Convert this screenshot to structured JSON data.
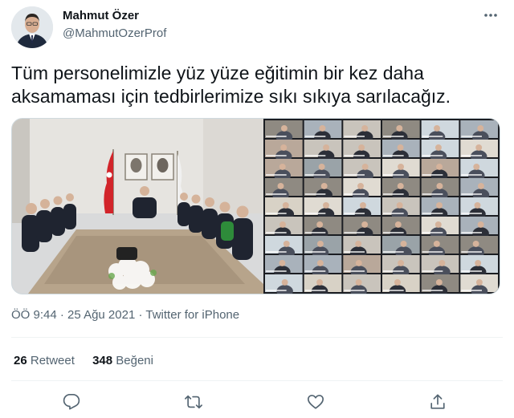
{
  "tweet": {
    "author_name": "Mahmut Özer",
    "author_handle": "@MahmutOzerProf",
    "text_lines": [
      "Tüm personelimizle yüz yüze eğitimin bir kez daha",
      "aksamaması için tedbirlerimize sıkı sıkıya sarılacağız."
    ],
    "time": "ÖÖ 9:44",
    "separator": "·",
    "date": "25 Ağu 2021",
    "source": "Twitter for iPhone"
  },
  "stats": {
    "retweets_count": "26",
    "retweets_label": "Retweet",
    "likes_count": "348",
    "likes_label": "Beğeni"
  },
  "icons": {
    "more": "more-icon",
    "reply": "reply-icon",
    "retweet": "retweet-icon",
    "like": "heart-icon",
    "share": "share-icon"
  },
  "colors": {
    "text": "#0f1419",
    "secondary": "#536471",
    "divider": "#eff3f4"
  }
}
